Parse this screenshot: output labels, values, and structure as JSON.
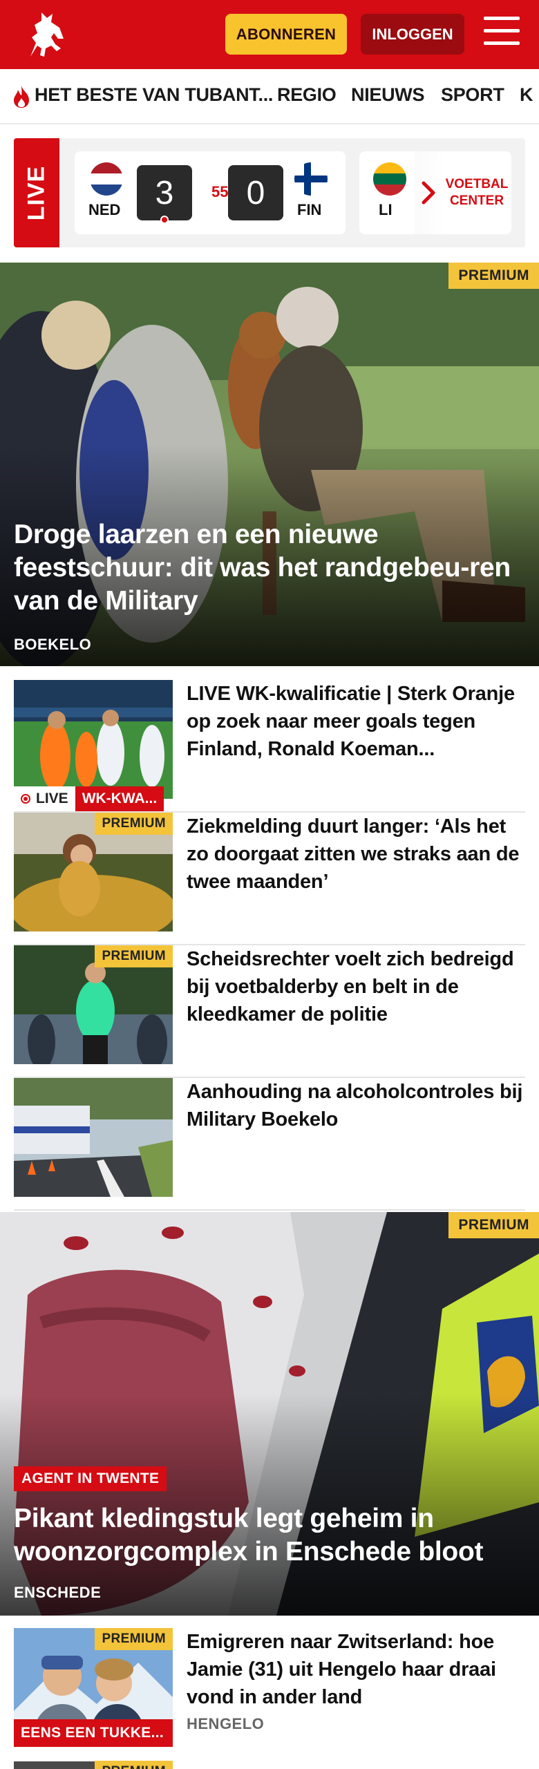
{
  "header": {
    "subscribe_label": "ABONNEREN",
    "login_label": "INLOGGEN",
    "colors": {
      "brand_red": "#d50c13",
      "subscribe_yellow": "#f9c32d",
      "login_darkred": "#9b0b0f"
    }
  },
  "nav": {
    "items": [
      {
        "label": "HET BESTE VAN TUBANT..."
      },
      {
        "label": "REGIO"
      },
      {
        "label": "NIEUWS"
      },
      {
        "label": "SPORT"
      },
      {
        "label": "K"
      }
    ]
  },
  "livebar": {
    "live_label": "LIVE",
    "match": {
      "home_code": "NED",
      "away_code": "FIN",
      "home_score": "3",
      "away_score": "0",
      "minute": "55'"
    },
    "next_match_code": "LI",
    "voetbal_center_label_1": "VOETBAL",
    "voetbal_center_label_2": "CENTER"
  },
  "hero1": {
    "badge": "PREMIUM",
    "title": "Droge laarzen en een nieuwe feestschuur: dit was het randgebeu-ren van de Military",
    "location": "BOEKELO"
  },
  "items": [
    {
      "title": "LIVE WK-kwalificatie | Sterk Oranje op zoek naar meer goals tegen Finland, Ronald Koeman...",
      "live_label": "LIVE",
      "tag": "WK-KWA..."
    },
    {
      "title": "Ziekmelding duurt langer: ‘Als het zo doorgaat zitten we straks aan de twee maanden’",
      "badge": "PREMIUM"
    },
    {
      "title": "Scheidsrechter voelt zich bedreigd bij voetbalderby en belt in de kleedkamer de politie",
      "badge": "PREMIUM"
    },
    {
      "title": "Aanhouding na alcoholcontroles bij Military Boekelo"
    }
  ],
  "hero2": {
    "badge": "PREMIUM",
    "tag": "AGENT IN TWENTE",
    "title": "Pikant kledingstuk legt geheim in woonzorgcomplex in Enschede bloot",
    "location": "ENSCHEDE"
  },
  "item5": {
    "title": "Emigreren naar Zwitserland: hoe Jamie (31) uit Hengelo haar draai vond in ander land",
    "badge": "PREMIUM",
    "tag": "EENS EEN TUKKE...",
    "location": "HENGELO"
  },
  "item6": {
    "badge": "PREMIUM"
  }
}
